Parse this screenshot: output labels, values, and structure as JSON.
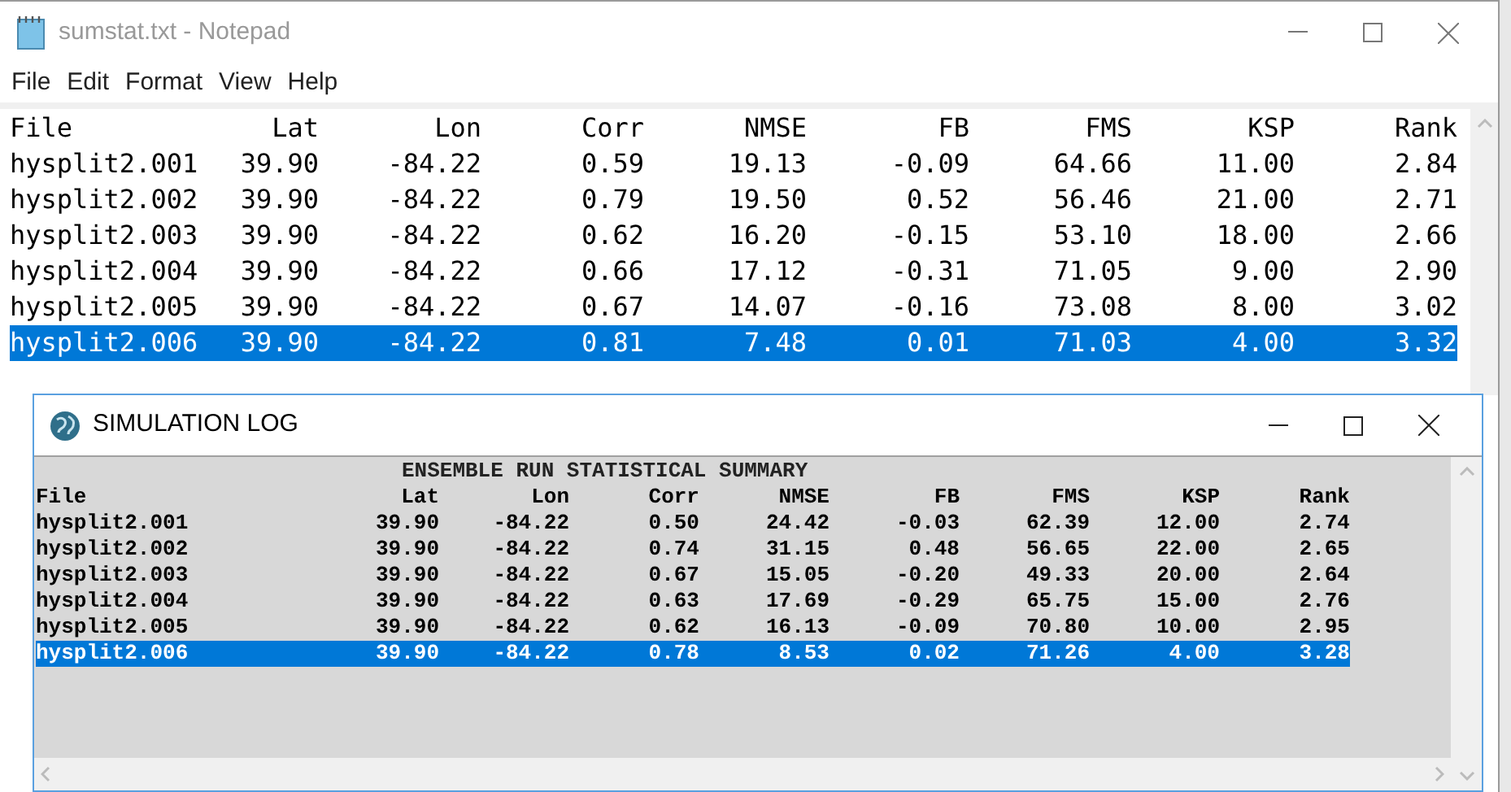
{
  "notepad": {
    "title": "sumstat.txt - Notepad",
    "menu": [
      "File",
      "Edit",
      "Format",
      "View",
      "Help"
    ],
    "table": {
      "columns": [
        "File",
        "Lat",
        "Lon",
        "Corr",
        "NMSE",
        "FB",
        "FMS",
        "KSP",
        "Rank"
      ],
      "rows": [
        {
          "cells": [
            "hysplit2.001",
            "39.90",
            "-84.22",
            "0.59",
            "19.13",
            "-0.09",
            "64.66",
            "11.00",
            "2.84"
          ],
          "selected": false
        },
        {
          "cells": [
            "hysplit2.002",
            "39.90",
            "-84.22",
            "0.79",
            "19.50",
            "0.52",
            "56.46",
            "21.00",
            "2.71"
          ],
          "selected": false
        },
        {
          "cells": [
            "hysplit2.003",
            "39.90",
            "-84.22",
            "0.62",
            "16.20",
            "-0.15",
            "53.10",
            "18.00",
            "2.66"
          ],
          "selected": false
        },
        {
          "cells": [
            "hysplit2.004",
            "39.90",
            "-84.22",
            "0.66",
            "17.12",
            "-0.31",
            "71.05",
            "9.00",
            "2.90"
          ],
          "selected": false
        },
        {
          "cells": [
            "hysplit2.005",
            "39.90",
            "-84.22",
            "0.67",
            "14.07",
            "-0.16",
            "73.08",
            "8.00",
            "3.02"
          ],
          "selected": false
        },
        {
          "cells": [
            "hysplit2.006",
            "39.90",
            "-84.22",
            "0.81",
            "7.48",
            "0.01",
            "71.03",
            "4.00",
            "3.32"
          ],
          "selected": true
        }
      ]
    }
  },
  "simulation_log": {
    "title": "SIMULATION LOG",
    "heading": "ENSEMBLE RUN STATISTICAL SUMMARY",
    "table": {
      "columns": [
        "File",
        "Lat",
        "Lon",
        "Corr",
        "NMSE",
        "FB",
        "FMS",
        "KSP",
        "Rank"
      ],
      "rows": [
        {
          "cells": [
            "hysplit2.001",
            "39.90",
            "-84.22",
            "0.50",
            "24.42",
            "-0.03",
            "62.39",
            "12.00",
            "2.74"
          ],
          "selected": false
        },
        {
          "cells": [
            "hysplit2.002",
            "39.90",
            "-84.22",
            "0.74",
            "31.15",
            "0.48",
            "56.65",
            "22.00",
            "2.65"
          ],
          "selected": false
        },
        {
          "cells": [
            "hysplit2.003",
            "39.90",
            "-84.22",
            "0.67",
            "15.05",
            "-0.20",
            "49.33",
            "20.00",
            "2.64"
          ],
          "selected": false
        },
        {
          "cells": [
            "hysplit2.004",
            "39.90",
            "-84.22",
            "0.63",
            "17.69",
            "-0.29",
            "65.75",
            "15.00",
            "2.76"
          ],
          "selected": false
        },
        {
          "cells": [
            "hysplit2.005",
            "39.90",
            "-84.22",
            "0.62",
            "16.13",
            "-0.09",
            "70.80",
            "10.00",
            "2.95"
          ],
          "selected": false
        },
        {
          "cells": [
            "hysplit2.006",
            "39.90",
            "-84.22",
            "0.78",
            "8.53",
            "0.02",
            "71.26",
            "4.00",
            "3.28"
          ],
          "selected": true
        }
      ]
    }
  }
}
